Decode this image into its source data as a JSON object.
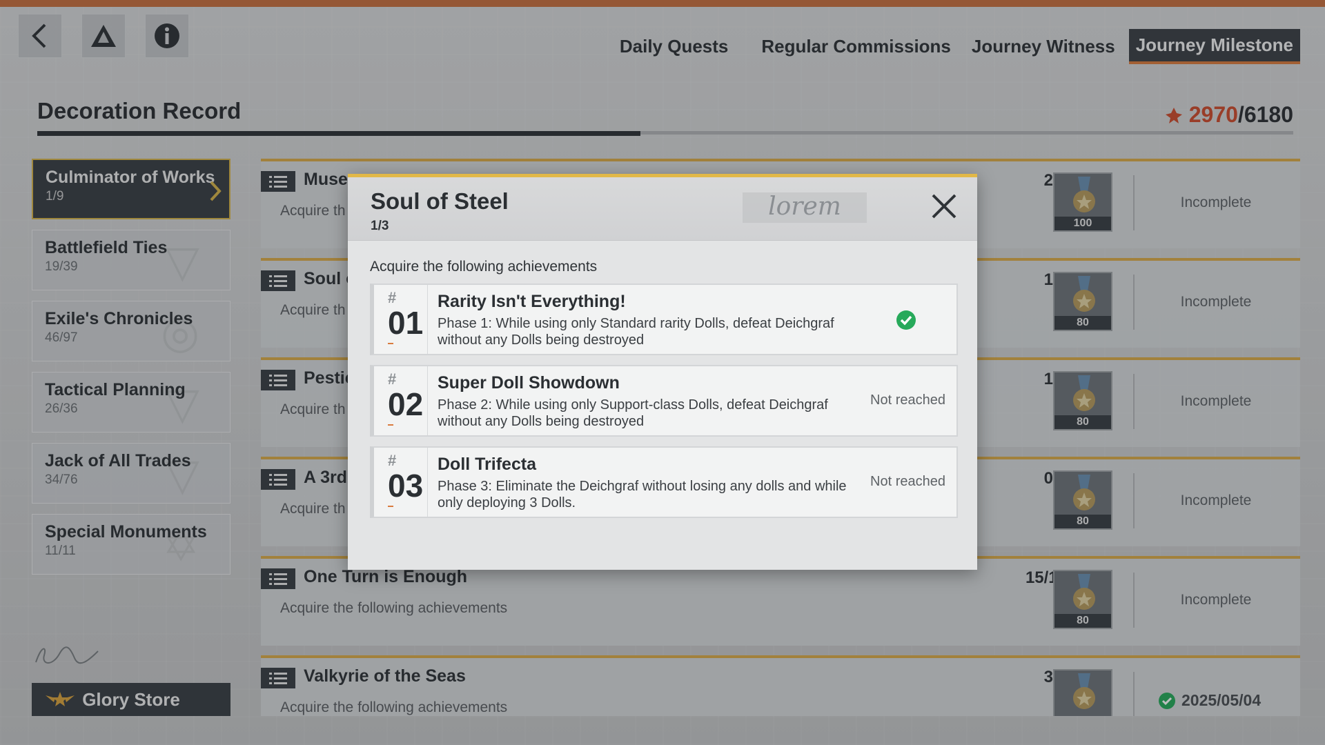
{
  "nav": {
    "tabs": [
      {
        "label": "Daily Quests"
      },
      {
        "label": "Regular Commissions"
      },
      {
        "label": "Journey Witness"
      },
      {
        "label": "Journey Milestone"
      }
    ]
  },
  "header": {
    "title": "Decoration Record",
    "score_current": "2970",
    "score_max": "/6180",
    "progress": 0.48
  },
  "sidebar": {
    "items": [
      {
        "name": "Culminator of Works",
        "count": "1/9"
      },
      {
        "name": "Battlefield Ties",
        "count": "19/39"
      },
      {
        "name": "Exile's Chronicles",
        "count": "46/97"
      },
      {
        "name": "Tactical Planning",
        "count": "26/36"
      },
      {
        "name": "Jack of All Trades",
        "count": "34/76"
      },
      {
        "name": "Special Monuments",
        "count": "11/11"
      }
    ],
    "glory_store": "Glory Store"
  },
  "rows": [
    {
      "title": "Muse",
      "desc": "Acquire th",
      "progress": "2/3",
      "reward": "100",
      "status": "Incomplete"
    },
    {
      "title": "Soul o",
      "desc": "Acquire th",
      "progress": "1/3",
      "reward": "80",
      "status": "Incomplete"
    },
    {
      "title": "Pestic",
      "desc": "Acquire th",
      "progress": "1/3",
      "reward": "80",
      "status": "Incomplete"
    },
    {
      "title": "A 3rd",
      "desc": "Acquire th",
      "progress": "0/3",
      "reward": "80",
      "status": "Incomplete"
    },
    {
      "title": "One Turn is Enough",
      "desc": "Acquire the following achievements",
      "progress": "15/18",
      "reward": "80",
      "status": "Incomplete"
    },
    {
      "title": "Valkyrie of the Seas",
      "desc": "Acquire the following achievements",
      "progress": "3/3",
      "reward": "",
      "status": "2025/05/04"
    }
  ],
  "modal": {
    "title": "Soul of Steel",
    "count": "1/3",
    "script_text": "lorem",
    "subtitle": "Acquire the following achievements",
    "achievements": [
      {
        "hash": "#",
        "num": "01",
        "title": "Rarity Isn't Everything!",
        "desc": "Phase 1: While using only Standard rarity Dolls, defeat Deichgraf without any Dolls being destroyed",
        "status": ""
      },
      {
        "hash": "#",
        "num": "02",
        "title": "Super Doll Showdown",
        "desc": "Phase 2: While using only Support-class Dolls, defeat Deichgraf without any Dolls being destroyed",
        "status": "Not reached"
      },
      {
        "hash": "#",
        "num": "03",
        "title": "Doll Trifecta",
        "desc": "Phase 3: Eliminate the Deichgraf without losing any dolls and while only deploying 3 Dolls.",
        "status": "Not reached"
      }
    ]
  },
  "colors": {
    "accent_orange": "#d97b3e",
    "accent_gold": "#e2b847",
    "score_red": "#cc4b2d",
    "check_green": "#27a95a",
    "dark": "#3a3f45"
  }
}
